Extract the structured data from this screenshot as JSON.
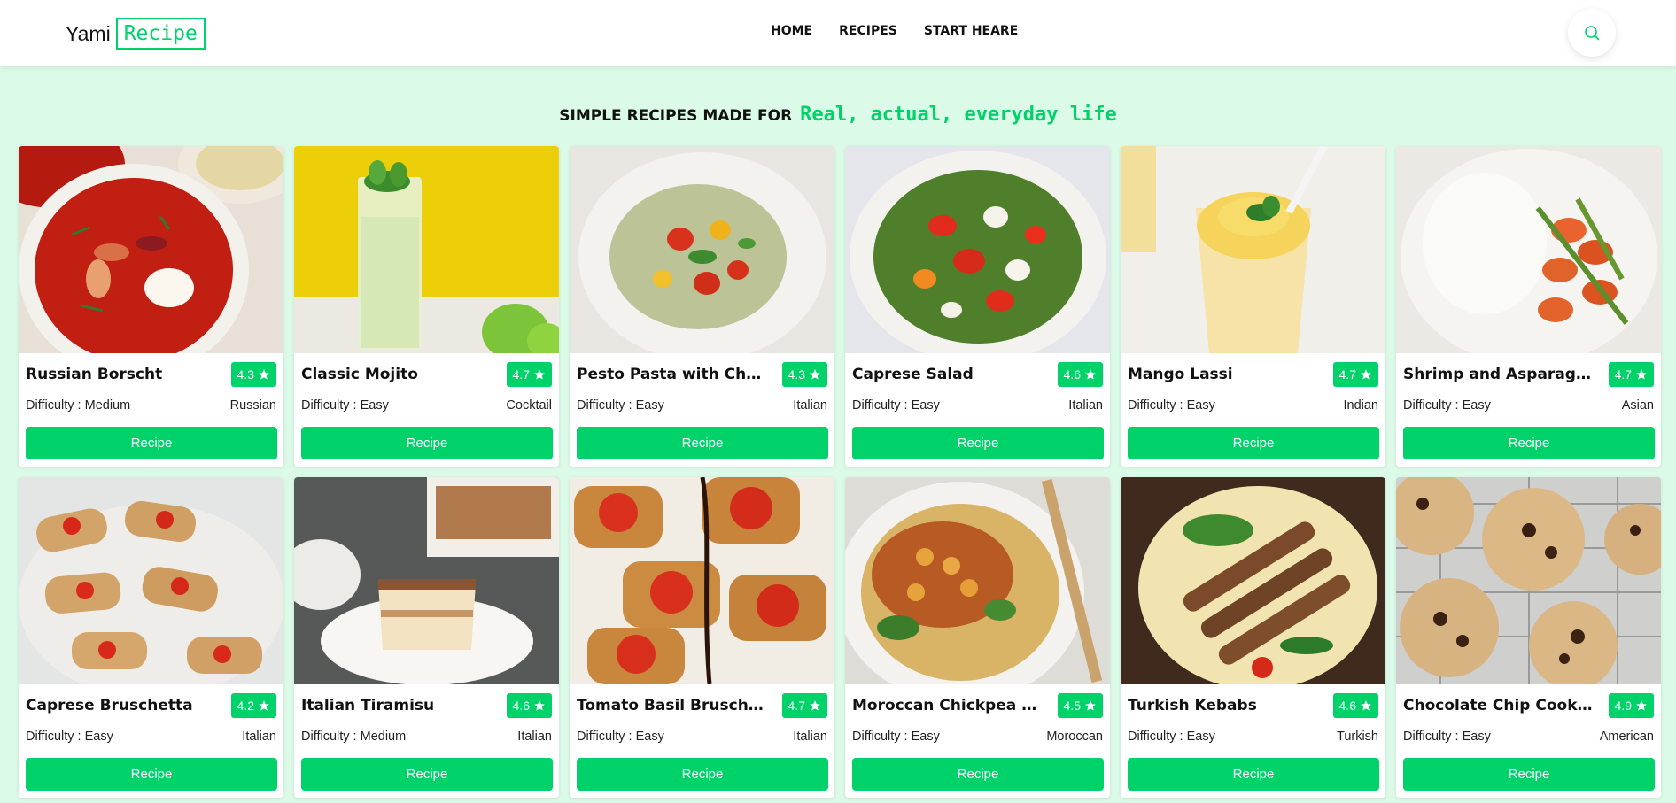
{
  "brand": {
    "part1": "Yami",
    "part2": "Recipe"
  },
  "nav": {
    "items": [
      "HOME",
      "RECIPES",
      "START HEARE"
    ]
  },
  "search": {
    "icon": "search-icon"
  },
  "headline": {
    "prefix": "SIMPLE RECIPES MADE FOR",
    "highlight": "Real, actual, everyday life"
  },
  "colors": {
    "accent": "#00d26a",
    "background": "#dcfae8"
  },
  "cards": [
    {
      "title": "Russian Borscht",
      "rating": "4.3",
      "difficulty": "Difficulty : Medium",
      "cuisine": "Russian",
      "button": "Recipe"
    },
    {
      "title": "Classic Mojito",
      "rating": "4.7",
      "difficulty": "Difficulty : Easy",
      "cuisine": "Cocktail",
      "button": "Recipe"
    },
    {
      "title": "Pesto Pasta with Cherr...",
      "rating": "4.3",
      "difficulty": "Difficulty : Easy",
      "cuisine": "Italian",
      "button": "Recipe"
    },
    {
      "title": "Caprese Salad",
      "rating": "4.6",
      "difficulty": "Difficulty : Easy",
      "cuisine": "Italian",
      "button": "Recipe"
    },
    {
      "title": "Mango Lassi",
      "rating": "4.7",
      "difficulty": "Difficulty : Easy",
      "cuisine": "Indian",
      "button": "Recipe"
    },
    {
      "title": "Shrimp and Asparagus ...",
      "rating": "4.7",
      "difficulty": "Difficulty : Easy",
      "cuisine": "Asian",
      "button": "Recipe"
    },
    {
      "title": "Caprese Bruschetta",
      "rating": "4.2",
      "difficulty": "Difficulty : Easy",
      "cuisine": "Italian",
      "button": "Recipe"
    },
    {
      "title": "Italian Tiramisu",
      "rating": "4.6",
      "difficulty": "Difficulty : Medium",
      "cuisine": "Italian",
      "button": "Recipe"
    },
    {
      "title": "Tomato Basil Bruschetta",
      "rating": "4.7",
      "difficulty": "Difficulty : Easy",
      "cuisine": "Italian",
      "button": "Recipe"
    },
    {
      "title": "Moroccan Chickpea Ta...",
      "rating": "4.5",
      "difficulty": "Difficulty : Easy",
      "cuisine": "Moroccan",
      "button": "Recipe"
    },
    {
      "title": "Turkish Kebabs",
      "rating": "4.6",
      "difficulty": "Difficulty : Easy",
      "cuisine": "Turkish",
      "button": "Recipe"
    },
    {
      "title": "Chocolate Chip Cookies",
      "rating": "4.9",
      "difficulty": "Difficulty : Easy",
      "cuisine": "American",
      "button": "Recipe"
    }
  ]
}
